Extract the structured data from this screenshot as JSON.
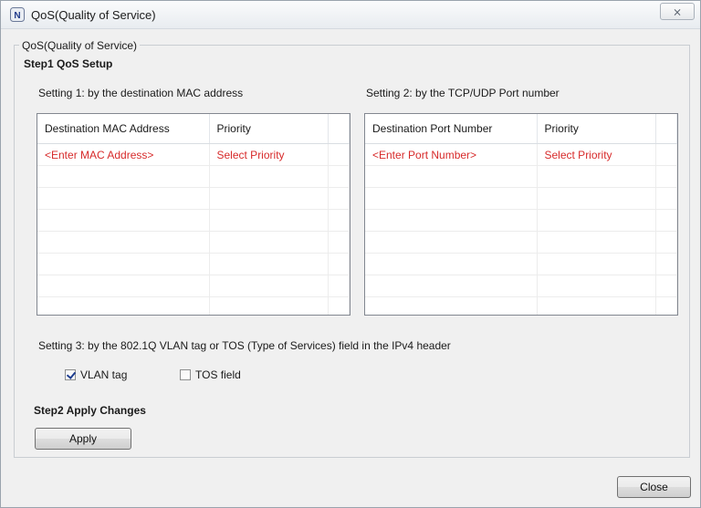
{
  "window": {
    "title": "QoS(Quality of Service)",
    "app_icon": "N",
    "close_glyph": "⨯"
  },
  "group": {
    "legend": "QoS(Quality of Service)"
  },
  "step1": {
    "label": "Step1   QoS Setup"
  },
  "setting1": {
    "label": "Setting 1: by the destination MAC address",
    "columns": [
      "Destination MAC Address",
      "Priority"
    ],
    "first_row": [
      "<Enter MAC Address>",
      "Select Priority"
    ]
  },
  "setting2": {
    "label": "Setting 2: by the TCP/UDP Port number",
    "columns": [
      "Destination Port Number",
      "Priority"
    ],
    "first_row": [
      "<Enter Port Number>",
      "Select Priority"
    ]
  },
  "setting3": {
    "label": "Setting 3: by the 802.1Q VLAN tag or TOS (Type of Services) field in the IPv4 header",
    "vlan": {
      "label": "VLAN tag",
      "checked": true
    },
    "tos": {
      "label": "TOS field",
      "checked": false
    }
  },
  "step2": {
    "label": "Step2   Apply Changes"
  },
  "buttons": {
    "apply": "Apply",
    "close": "Close"
  },
  "colors": {
    "placeholder_text": "#d72a2a",
    "grid_border": "#828790"
  }
}
